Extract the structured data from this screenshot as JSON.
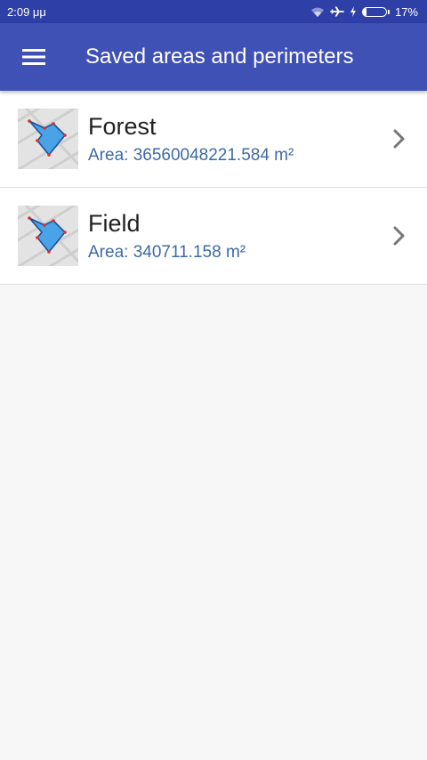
{
  "status_bar": {
    "time": "2:09 μμ",
    "battery_percent": "17%",
    "battery_level": 0.17,
    "icons": [
      "wifi-icon",
      "airplane-icon",
      "charging-icon",
      "battery-icon"
    ]
  },
  "app_bar": {
    "title": "Saved areas and perimeters",
    "menu_icon": "hamburger-menu-icon"
  },
  "colors": {
    "status_bar": "#2f3fa8",
    "app_bar": "#3f51b5",
    "area_text": "#3d6aa6",
    "polygon_fill": "#4aa3e6",
    "background": "#f7f7f7"
  },
  "items": [
    {
      "name": "Forest",
      "area": "Area: 36560048221.584 m²",
      "icon": "area-map-thumbnail-icon",
      "action_icon": "chevron-right-icon"
    },
    {
      "name": "Field",
      "area": "Area: 340711.158 m²",
      "icon": "area-map-thumbnail-icon",
      "action_icon": "chevron-right-icon"
    }
  ]
}
